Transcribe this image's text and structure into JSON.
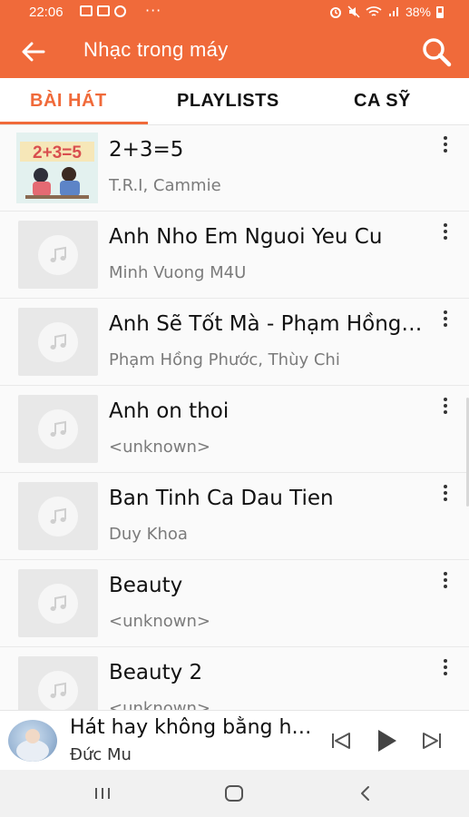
{
  "status_bar": {
    "time": "22:06",
    "dots": "···",
    "battery": "38%",
    "icons": [
      "image-icon",
      "message-icon",
      "facebook-icon",
      "alarm-icon",
      "mute-icon",
      "wifi-icon",
      "signal-icon",
      "battery-icon"
    ]
  },
  "app_bar": {
    "title": "Nhạc trong máy",
    "back_icon": "arrow-left-icon",
    "search_icon": "search-icon",
    "color": "#f06a3a"
  },
  "tabs": [
    {
      "label": "BÀI HÁT",
      "active": true
    },
    {
      "label": "PLAYLISTS",
      "active": false
    },
    {
      "label": "CA SỸ",
      "active": false
    }
  ],
  "songs": [
    {
      "title": "2+3=5",
      "artist": "T.R.I, Cammie",
      "cover": "custom-art"
    },
    {
      "title": "Anh Nho Em Nguoi Yeu Cu",
      "artist": "Minh Vuong M4U",
      "cover": "music-note-icon"
    },
    {
      "title": "Anh Sẽ Tốt Mà - Phạm Hồng Phước",
      "artist": "Phạm Hồng Phước, Thùy Chi",
      "cover": "music-note-icon"
    },
    {
      "title": "Anh on thoi",
      "artist": "<unknown>",
      "cover": "music-note-icon"
    },
    {
      "title": "Ban Tinh Ca Dau Tien",
      "artist": "Duy Khoa",
      "cover": "music-note-icon"
    },
    {
      "title": "Beauty",
      "artist": "<unknown>",
      "cover": "music-note-icon"
    },
    {
      "title": "Beauty 2",
      "artist": "<unknown>",
      "cover": "music-note-icon"
    }
  ],
  "cover_art_text": "2+3=5",
  "mini_player": {
    "title": "Hát hay không bằng hay hát",
    "artist": "Đức Mu",
    "buttons": [
      "skip-previous-icon",
      "play-icon",
      "skip-next-icon"
    ]
  },
  "nav_bar": {
    "buttons": [
      "recent-apps-icon",
      "home-icon",
      "back-icon"
    ]
  }
}
